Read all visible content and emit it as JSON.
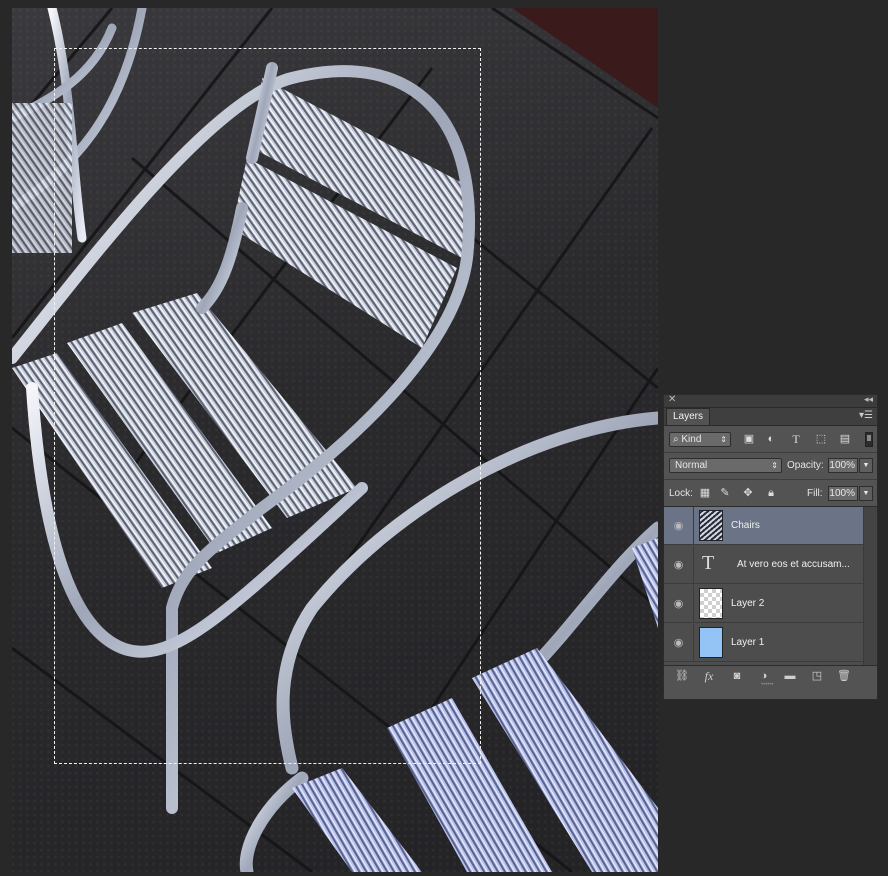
{
  "document": {
    "image_description_name": "chairs-photo"
  },
  "layers_panel": {
    "tab_label": "Layers",
    "filter": {
      "kind_label": "Kind",
      "icons": [
        "image-filter-icon",
        "adjustment-filter-icon",
        "type-filter-icon",
        "shape-filter-icon",
        "smart-object-filter-icon"
      ],
      "type_glyph": "T"
    },
    "blend_mode": "Normal",
    "opacity_label": "Opacity:",
    "opacity_value": "100%",
    "lock_label": "Lock:",
    "fill_label": "Fill:",
    "fill_value": "100%",
    "layers": [
      {
        "name": "Chairs",
        "kind": "image",
        "selected": true
      },
      {
        "name": "At vero eos et accusam...",
        "kind": "text",
        "glyph": "T",
        "selected": false
      },
      {
        "name": "Layer 2",
        "kind": "transparent",
        "selected": false
      },
      {
        "name": "Layer 1",
        "kind": "fill",
        "color": "#94c4f5",
        "selected": false
      }
    ],
    "bottom_icons": [
      "link-layers-icon",
      "fx-icon",
      "add-mask-icon",
      "new-adjustment-icon",
      "new-group-icon",
      "new-layer-icon",
      "trash-icon"
    ],
    "fx_label": "fx"
  },
  "colors": {
    "app_background": "#282828",
    "panel_background": "#535353",
    "selected_layer": "#6b7387",
    "layer1_fill": "#94c4f5"
  }
}
